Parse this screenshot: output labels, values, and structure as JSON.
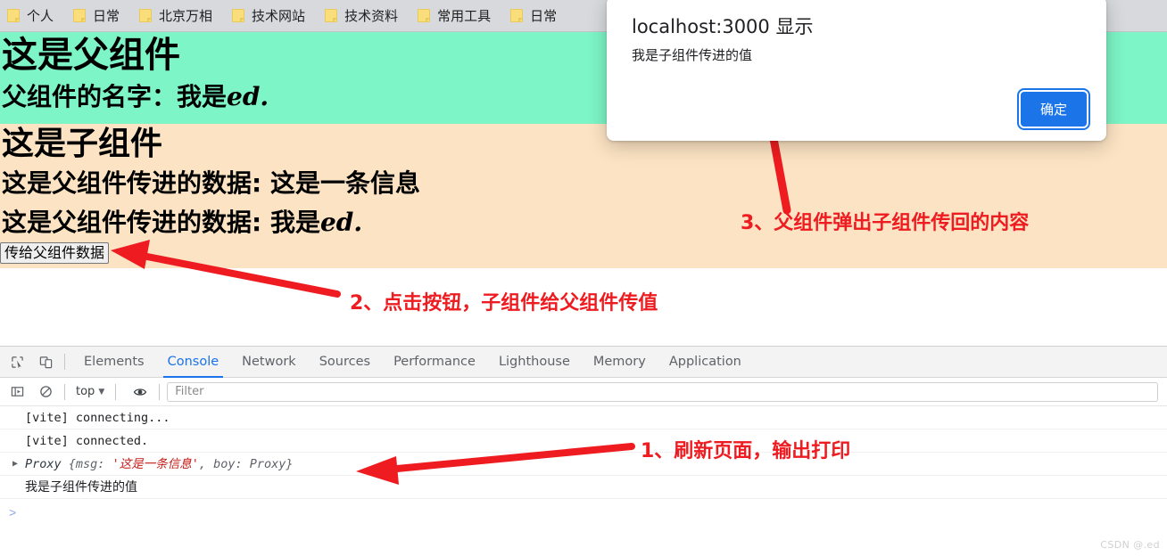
{
  "bookmarks": {
    "items": [
      {
        "label": "个人",
        "icon": "folder-icon"
      },
      {
        "label": "日常",
        "icon": "folder-icon"
      },
      {
        "label": "北京万相",
        "icon": "folder-icon"
      },
      {
        "label": "技术网站",
        "icon": "folder-icon"
      },
      {
        "label": "技术资料",
        "icon": "folder-icon"
      },
      {
        "label": "常用工具",
        "icon": "folder-icon"
      },
      {
        "label": "日常",
        "icon": "folder-icon"
      }
    ]
  },
  "page": {
    "parent_heading": "这是父组件",
    "parent_name_label": "父组件的名字：我是",
    "parent_name_value": "ed.",
    "child_heading": "这是子组件",
    "child_line1": "这是父组件传进的数据: 这是一条信息",
    "child_line2_label": "这是父组件传进的数据: 我是",
    "child_line2_value": "ed.",
    "child_button": "传给父组件数据",
    "green_bg": "#7df5c6",
    "orange_bg": "#fce3c3"
  },
  "dialog": {
    "title": "localhost:3000 显示",
    "message": "我是子组件传进的值",
    "ok_label": "确定",
    "accent": "#1b75e8"
  },
  "annotations": {
    "color": "#ee1c20",
    "note1": "1、刷新页面，输出打印",
    "note2": "2、点击按钮，子组件给父组件传值",
    "note3": "3、父组件弹出子组件传回的内容"
  },
  "devtools": {
    "left_icons": [
      {
        "name": "inspect-element-icon"
      },
      {
        "name": "device-toolbar-icon"
      }
    ],
    "tabs": [
      {
        "label": "Elements",
        "active": false
      },
      {
        "label": "Console",
        "active": true
      },
      {
        "label": "Network",
        "active": false
      },
      {
        "label": "Sources",
        "active": false
      },
      {
        "label": "Performance",
        "active": false
      },
      {
        "label": "Lighthouse",
        "active": false
      },
      {
        "label": "Memory",
        "active": false
      },
      {
        "label": "Application",
        "active": false
      }
    ],
    "toolbar": {
      "sidebar_toggle_icon": "console-sidebar-icon",
      "clear_icon": "clear-console-icon",
      "context": "top",
      "eye_icon": "live-expression-icon",
      "filter_placeholder": "Filter",
      "filter_value": ""
    },
    "console": {
      "rows": [
        {
          "type": "plain",
          "text": "[vite] connecting..."
        },
        {
          "type": "plain",
          "text": "[vite] connected."
        },
        {
          "type": "object",
          "arrow": "▶",
          "obj": "Proxy ",
          "brace_open": "{",
          "key1": "msg: ",
          "str1": "'这是一条信息'",
          "sep": ", ",
          "key2": "boy: Proxy",
          "brace_close": "}"
        },
        {
          "type": "cjk",
          "text": "我是子组件传进的值"
        }
      ],
      "prompt": ">"
    }
  },
  "watermark": "CSDN @.ed"
}
